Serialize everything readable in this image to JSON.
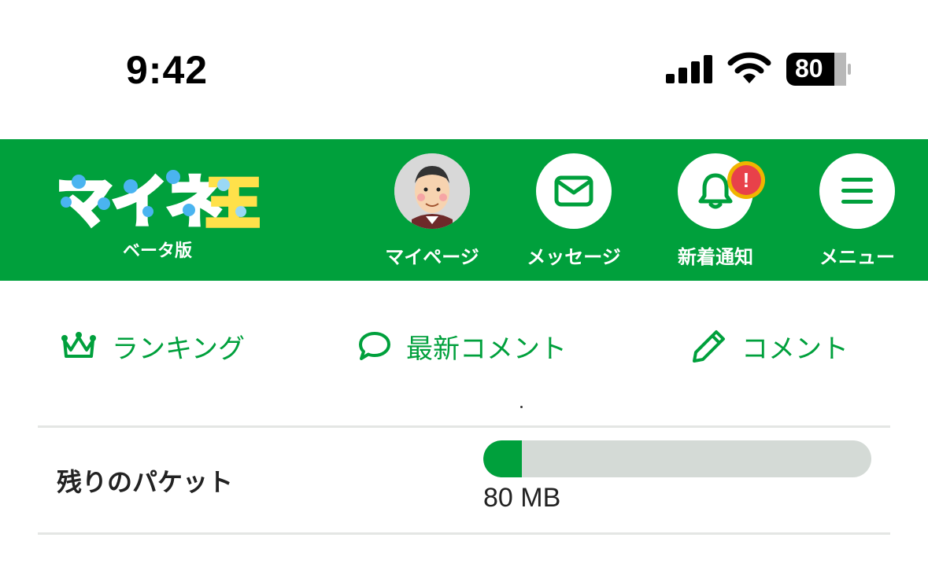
{
  "status_bar": {
    "time": "9:42",
    "battery": "80",
    "icons": [
      "signal-icon",
      "wifi-icon",
      "battery-icon"
    ]
  },
  "header": {
    "logo_text": "マイネ王",
    "logo_sub": "ベータ版",
    "background_color": "#00a03c",
    "nav": [
      {
        "label": "マイページ",
        "icon": "avatar"
      },
      {
        "label": "メッセージ",
        "icon": "mail-icon"
      },
      {
        "label": "新着通知",
        "icon": "bell-icon",
        "badge": "!"
      },
      {
        "label": "メニュー",
        "icon": "hamburger-icon"
      }
    ]
  },
  "subnav": [
    {
      "label": "ランキング",
      "icon": "crown-icon"
    },
    {
      "label": "最新コメント",
      "icon": "speech-bubble-icon"
    },
    {
      "label": "コメント",
      "icon": "pencil-icon"
    }
  ],
  "packet": {
    "label": "残りのパケット",
    "value": "80 MB",
    "fill_fraction": 0.1,
    "fill_color": "#00a03c",
    "track_color": "#d4dad6"
  }
}
